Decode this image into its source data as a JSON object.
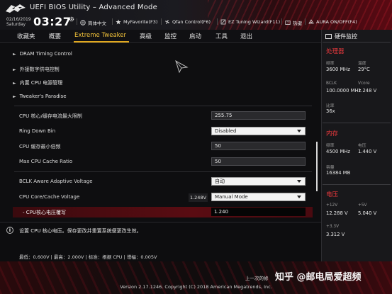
{
  "header": {
    "title": "UEFI BIOS Utility – Advanced Mode",
    "date": "02/16/2019",
    "day": "Saturday",
    "time": "03:27",
    "items": [
      {
        "icon": "globe-icon",
        "label": "简体中文"
      },
      {
        "icon": "star-icon",
        "label": "MyFavorite(F3)"
      },
      {
        "icon": "fan-icon",
        "label": "Qfan Control(F6)"
      },
      {
        "icon": "tuning-icon",
        "label": "EZ Tuning Wizard(F11)"
      },
      {
        "icon": "hotkey-icon",
        "label": "热键"
      },
      {
        "icon": "aura-icon",
        "label": "AURA ON/OFF(F4)"
      }
    ]
  },
  "menu": {
    "tabs": [
      "收藏夹",
      "概要",
      "Extreme Tweaker",
      "高级",
      "监控",
      "启动",
      "工具",
      "退出"
    ],
    "active_index": 2
  },
  "main": {
    "nav_items": [
      "DRAM Timing Control",
      "外接数字供电控制",
      "内置 CPU 电源管理",
      "Tweaker's Paradise"
    ],
    "settings": [
      {
        "label": "CPU 核心/缓存电流最大限制",
        "value": "255.75",
        "kind": "field"
      },
      {
        "label": "Ring Down Bin",
        "value": "Disabled",
        "kind": "dropdown"
      },
      {
        "label": "CPU 缓存最小倍频",
        "value": "50",
        "kind": "field"
      },
      {
        "label": "Max CPU Cache Ratio",
        "value": "50",
        "kind": "field"
      },
      {
        "label": "BCLK Aware Adaptive Voltage",
        "value": "自动",
        "kind": "dropdown"
      },
      {
        "label": "CPU Core/Cache Voltage",
        "value": "Manual Mode",
        "kind": "dropdown",
        "current": "1.248V"
      }
    ],
    "selected": {
      "label": "- CPU核心电压覆写",
      "value": "1.240"
    }
  },
  "help": {
    "text": "设置 CPU 核心电压。保存更改并重置系统便更改生效。",
    "range": "最低：0.600V  |  最高：2.000V  |  标准：根据 CPU  |  增幅：0.005V"
  },
  "hw_monitor": {
    "title": "硬件监控",
    "cpu": {
      "section": "处理器",
      "freq_label": "频率",
      "freq": "3600 MHz",
      "temp_label": "温度",
      "temp": "29°C",
      "bclk_label": "BCLK",
      "bclk": "100.0000 MHz",
      "vcore_label": "Vcore",
      "vcore": "1.248 V",
      "ratio_label": "比率",
      "ratio": "36x"
    },
    "memory": {
      "section": "内存",
      "freq_label": "频率",
      "freq": "4500 MHz",
      "volt_label": "电压",
      "volt": "1.440 V",
      "cap_label": "容量",
      "cap": "16384 MB"
    },
    "voltage": {
      "section": "电压",
      "v12_label": "+12V",
      "v12": "12.288 V",
      "v5_label": "+5V",
      "v5": "5.040 V",
      "v33_label": "+3.3V",
      "v33": "3.312 V"
    }
  },
  "footer": {
    "last_modified": "上一次的修",
    "version": "Version 2.17.1246. Copyright (C) 2018 American Megatrends, Inc.",
    "watermark": "知乎 @邮电局爱超频"
  },
  "colors": {
    "accent": "#e0a81e",
    "rog_red": "#e6383c",
    "selected_row": "#5a0c12"
  }
}
